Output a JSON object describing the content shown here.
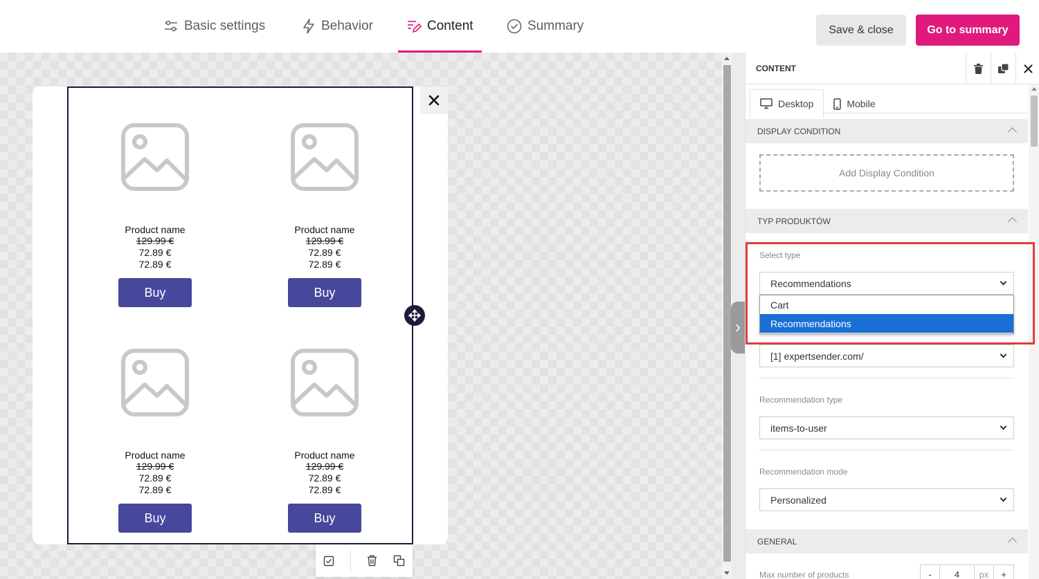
{
  "topbar": {
    "tabs": [
      {
        "label": "Basic settings",
        "icon": "sliders-icon"
      },
      {
        "label": "Behavior",
        "icon": "lightning-icon"
      },
      {
        "label": "Content",
        "icon": "content-edit-icon",
        "active": true
      },
      {
        "label": "Summary",
        "icon": "check-circle-icon"
      }
    ],
    "save_label": "Save & close",
    "summary_label": "Go to summary"
  },
  "colors": {
    "accent": "#e0197d",
    "buy_button": "#47479c",
    "frame": "#1c1b3a",
    "dropdown_selected": "#1a6fd6",
    "highlight": "#e23b3b"
  },
  "popup": {
    "close_icon": "×",
    "products": [
      {
        "name": "Product name",
        "old_price": "129.99 €",
        "price1": "72.89 €",
        "price2": "72.89 €",
        "buy": "Buy"
      },
      {
        "name": "Product name",
        "old_price": "129.99 €",
        "price1": "72.89 €",
        "price2": "72.89 €",
        "buy": "Buy"
      },
      {
        "name": "Product name",
        "old_price": "129.99 €",
        "price1": "72.89 €",
        "price2": "72.89 €",
        "buy": "Buy"
      },
      {
        "name": "Product name",
        "old_price": "129.99 €",
        "price1": "72.89 €",
        "price2": "72.89 €",
        "buy": "Buy"
      }
    ]
  },
  "panel": {
    "title": "CONTENT",
    "device_tabs": [
      {
        "label": "Desktop"
      },
      {
        "label": "Mobile"
      }
    ],
    "display_condition": {
      "heading": "DISPLAY CONDITION",
      "add_label": "Add Display Condition"
    },
    "product_type": {
      "heading": "TYP PRODUKTÓW",
      "select_type_label": "Select type",
      "select_type_value": "Recommendations",
      "options": [
        "Cart",
        "Recommendations"
      ],
      "site_value": "[1] expertsender.com/",
      "rec_type_label": "Recommendation type",
      "rec_type_value": "items-to-user",
      "rec_mode_label": "Recommendation mode",
      "rec_mode_value": "Personalized"
    },
    "general": {
      "heading": "GENERAL",
      "max_label": "Max number of products",
      "minus": "-",
      "value": "4",
      "unit": "px",
      "plus": "+"
    }
  }
}
